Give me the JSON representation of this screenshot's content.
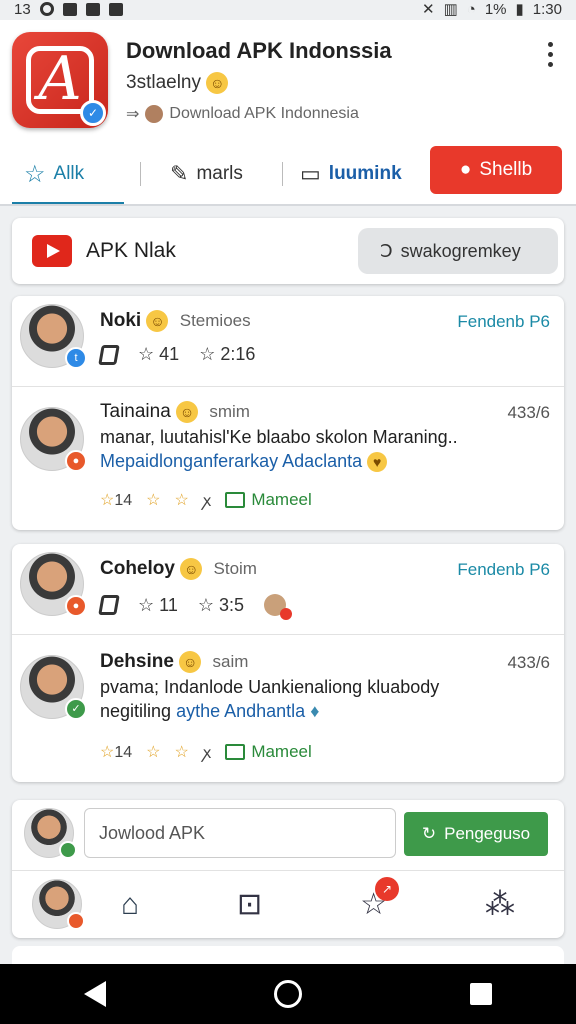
{
  "status": {
    "left_time": "13",
    "time": "1:30",
    "battery": "1%"
  },
  "app": {
    "title": "Download APK Indonssia",
    "subtitle": "3stlaelny",
    "source": "Download APK Indonnesia",
    "icon_glyph": "A"
  },
  "tabs": [
    {
      "label": "Allk",
      "icon": "star-icon"
    },
    {
      "label": "marls",
      "icon": "pen-icon"
    },
    {
      "label": "luumink",
      "icon": "browser-icon"
    }
  ],
  "share_label": "Shellb",
  "channel": {
    "name": "APK Nlak",
    "search_label": "swakogremkey"
  },
  "card1": {
    "user1": {
      "name": "Noki",
      "tag": "Stemioes",
      "follow": "Fendenb P6",
      "stat1": "41",
      "stat2": "2:16"
    },
    "user2": {
      "name": "Tainaina",
      "tag": "smim",
      "time": "433/6",
      "line1": "manar, luutahisl'Ke blaabo skolon Maraning..",
      "line2": "Mepaidlonganferarkay Adaclanta",
      "react_count": "14",
      "mark": "Mameel"
    }
  },
  "card2": {
    "user1": {
      "name": "Coheloy",
      "tag": "Stoim",
      "follow": "Fendenb P6",
      "stat1": "11",
      "stat2": "3:5"
    },
    "user2": {
      "name": "Dehsine",
      "tag": "saim",
      "time": "433/6",
      "line1": "pvama; Indanlode Uankienaliong kluabody",
      "line2a": "negitiling",
      "line2b": "aythe Andhantla",
      "react_count": "14",
      "mark": "Mameel"
    }
  },
  "composer": {
    "placeholder": "Jowlood APK",
    "send_label": "Pengeguso"
  },
  "colors": {
    "accent": "#1b7fa8",
    "share": "#e8392b",
    "send": "#3e9a4a"
  }
}
